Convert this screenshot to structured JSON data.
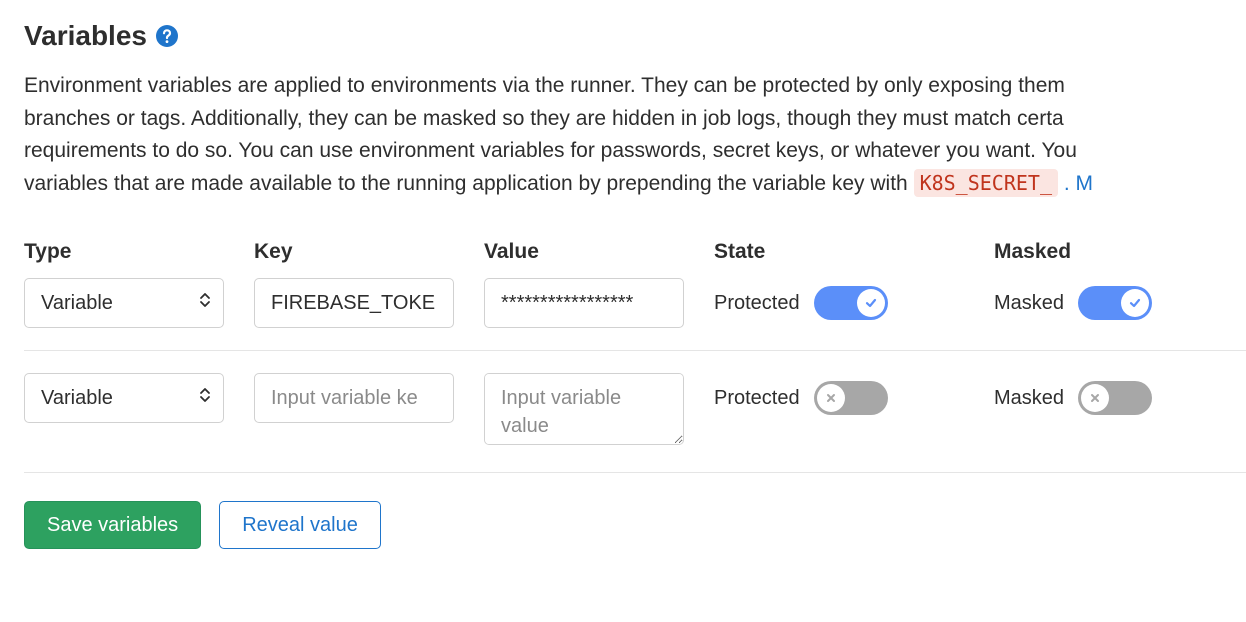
{
  "title": "Variables",
  "description": {
    "line1": "Environment variables are applied to environments via the runner. They can be protected by only exposing them",
    "line2_a": "branches or tags. Additionally, they can be masked so they are hidden in job logs, though they must match certa",
    "line3": "requirements to do so. You can use environment variables for passwords, secret keys, or whatever you want. You",
    "line4_a": "variables that are made available to the running application by prepending the variable key with ",
    "code": "K8S_SECRET_",
    "line4_b": ". M"
  },
  "table": {
    "headers": {
      "type": "Type",
      "key": "Key",
      "value": "Value",
      "state": "State",
      "masked": "Masked"
    },
    "rows": [
      {
        "type": "Variable",
        "key": "FIREBASE_TOKE",
        "value": "*****************",
        "state_label": "Protected",
        "state_on": true,
        "masked_label": "Masked",
        "masked_on": true
      },
      {
        "type": "Variable",
        "key_placeholder": "Input variable ke",
        "value_placeholder": "Input variable value",
        "state_label": "Protected",
        "state_on": false,
        "masked_label": "Masked",
        "masked_on": false
      }
    ]
  },
  "actions": {
    "save": "Save variables",
    "reveal": "Reveal value"
  }
}
